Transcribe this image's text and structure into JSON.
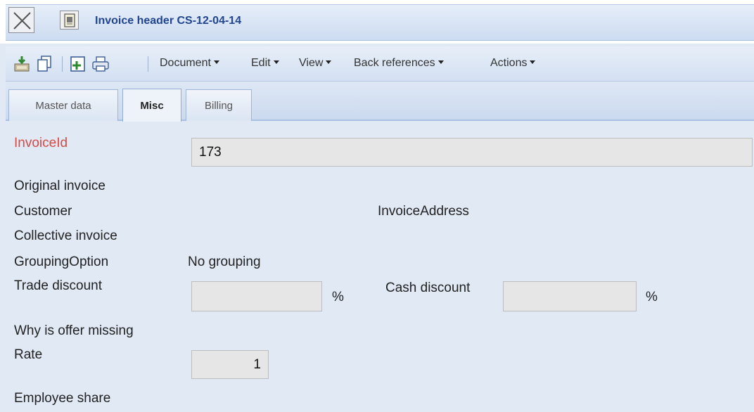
{
  "window": {
    "title": "Invoice header CS-12-04-14"
  },
  "toolbar": {
    "icons": [
      "save-icon",
      "copy-icon",
      "new-document-icon",
      "print-icon"
    ],
    "menus": [
      "Document",
      "Edit",
      "View",
      "Back references",
      "Actions"
    ]
  },
  "tabs": [
    {
      "label": "Master data",
      "active": false
    },
    {
      "label": "Misc",
      "active": true
    },
    {
      "label": "Billing",
      "active": false
    }
  ],
  "form": {
    "invoice_id": {
      "label": "InvoiceId",
      "value": "173"
    },
    "original_invoice": {
      "label": "Original invoice"
    },
    "customer": {
      "label": "Customer"
    },
    "invoice_address": {
      "label": "InvoiceAddress"
    },
    "collective_invoice": {
      "label": "Collective invoice"
    },
    "grouping_option": {
      "label": "GroupingOption",
      "value": "No grouping"
    },
    "trade_discount": {
      "label": "Trade discount",
      "value": "",
      "unit": "%"
    },
    "cash_discount": {
      "label": "Cash discount",
      "value": "",
      "unit": "%"
    },
    "why_offer_missing": {
      "label": "Why is offer missing"
    },
    "rate": {
      "label": "Rate",
      "value": "1"
    },
    "employee_share": {
      "label": "Employee share"
    }
  },
  "colors": {
    "background": "#e1e9f5",
    "title": "#21468f",
    "required_label": "#d44a45"
  }
}
